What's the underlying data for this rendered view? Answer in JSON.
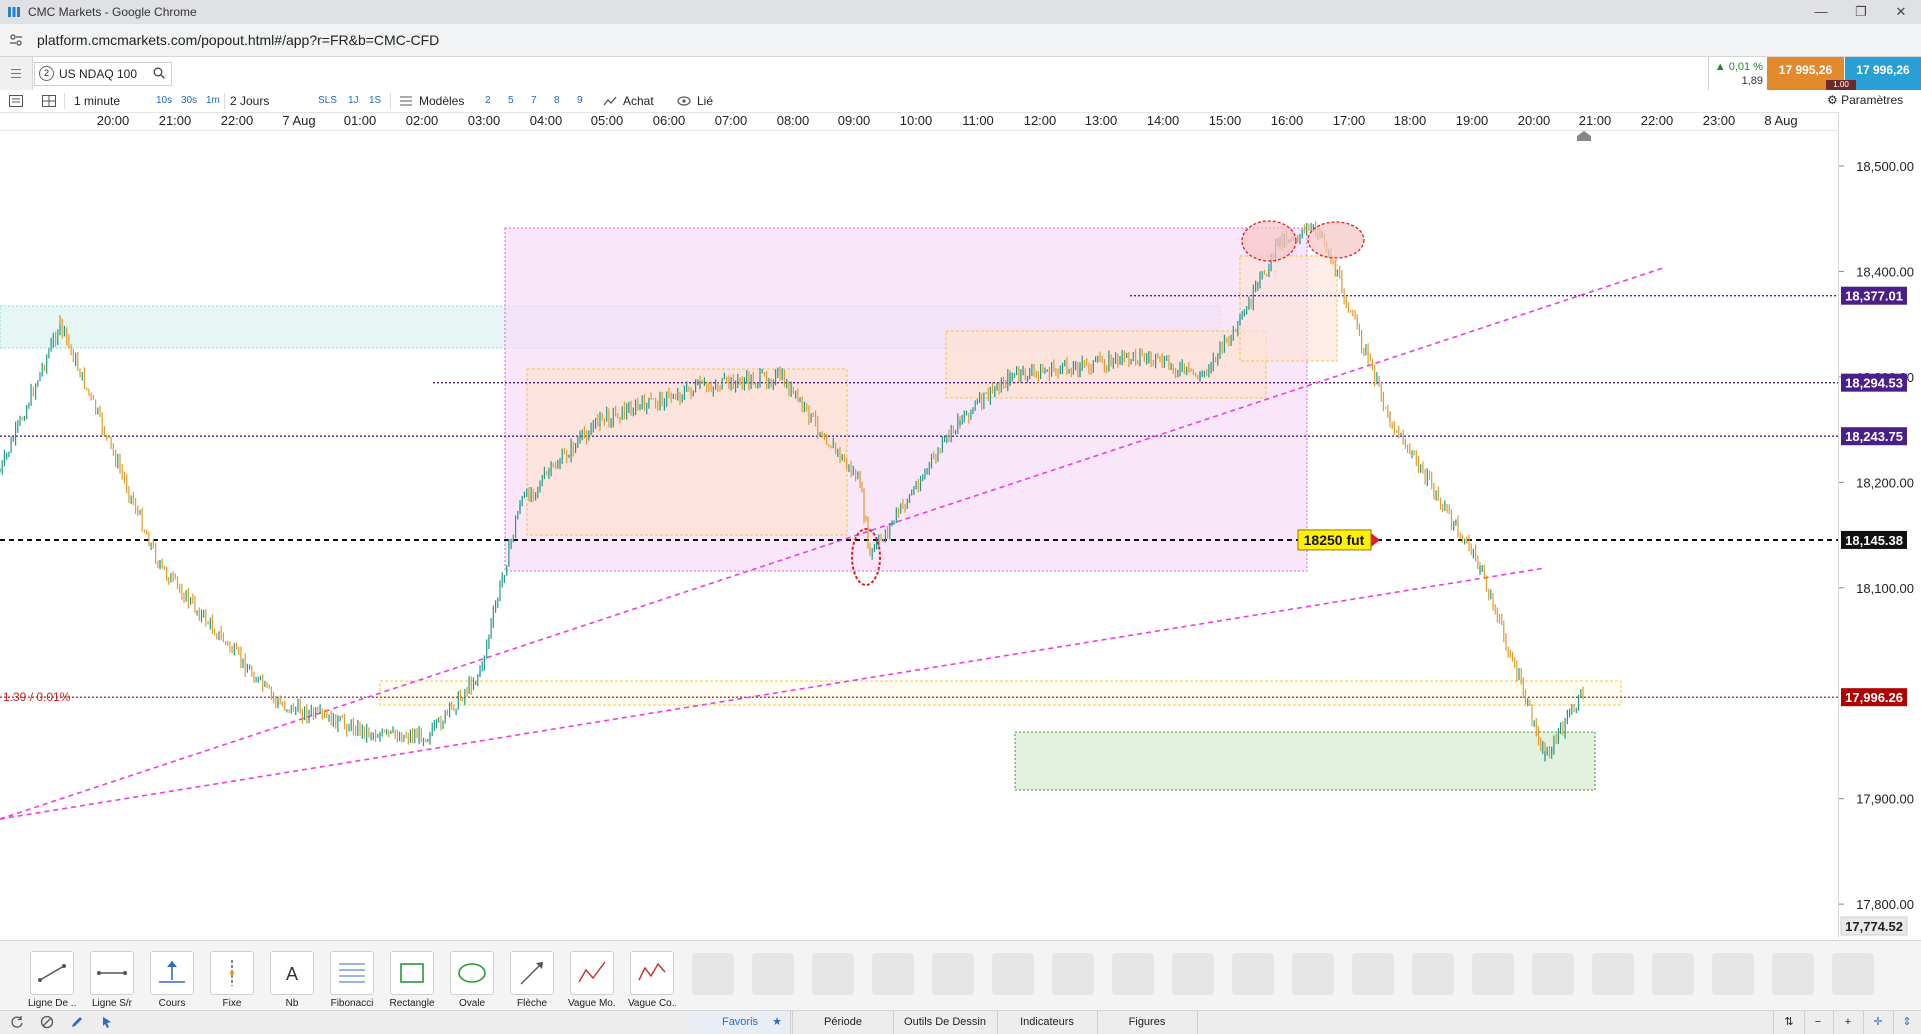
{
  "window": {
    "title": "CMC Markets - Google Chrome",
    "url": "platform.cmcmarkets.com/popout.html#/app?r=FR&b=CMC-CFD"
  },
  "instrument": {
    "number": "2",
    "name": "US NDAQ 100",
    "change_pct": "0,01 %",
    "change_abs": "1,89",
    "sell": "17 995,26",
    "buy": "17 996,26",
    "spread": "1.00"
  },
  "toolbar": {
    "interval": "1 minute",
    "quick_intervals": [
      "10s",
      "30s",
      "1m"
    ],
    "range": "2 Jours",
    "quick_ranges": [
      "SLS",
      "1J",
      "1S"
    ],
    "templates": "Modèles",
    "numbers": [
      "2",
      "5",
      "7",
      "8",
      "9"
    ],
    "buy": "Achat",
    "linked": "Lié",
    "settings": "Paramètres"
  },
  "time_axis": [
    "20:00",
    "21:00",
    "22:00",
    "7 Aug",
    "01:00",
    "02:00",
    "03:00",
    "04:00",
    "05:00",
    "06:00",
    "07:00",
    "08:00",
    "09:00",
    "10:00",
    "11:00",
    "12:00",
    "13:00",
    "14:00",
    "15:00",
    "16:00",
    "17:00",
    "18:00",
    "19:00",
    "20:00",
    "21:00",
    "22:00",
    "23:00",
    "8 Aug"
  ],
  "price_axis": [
    "18,500.00",
    "18,400.00",
    "18,300.00",
    "18,200.00",
    "18,100.00",
    "17,900.00",
    "17,800.00"
  ],
  "price_labels": {
    "line1": "18,377.01",
    "line2": "18,294.53",
    "line3": "18,243.75",
    "black_line": "18,145.38",
    "current": "17,996.26",
    "bottom": "17,774.52"
  },
  "annotations": {
    "fut_label": "18250 fut",
    "change_label": "1.39 / 0.01%"
  },
  "colors": {
    "bull": "#1e9a8a",
    "bear": "#e39a2c",
    "current_price": "#b00000",
    "level_lines": "#4b1f8a",
    "trendlines": "#ee3de0"
  },
  "chart_data": {
    "type": "line",
    "instrument": "US NDAQ 100",
    "interval": "1 minute",
    "x": [
      "20:00",
      "21:00",
      "22:00",
      "7 Aug",
      "01:00",
      "02:00",
      "03:00",
      "04:00",
      "05:00",
      "06:00",
      "07:00",
      "08:00",
      "09:00",
      "10:00",
      "11:00",
      "12:00",
      "13:00",
      "14:00",
      "15:00",
      "16:00",
      "17:00",
      "18:00",
      "19:00",
      "20:00",
      "20:45"
    ],
    "series": [
      {
        "values": [
          18210,
          18350,
          18120,
          17990,
          17960,
          17960,
          18020,
          18180,
          18260,
          18290,
          18300,
          18200,
          18130,
          18260,
          18300,
          18310,
          18320,
          18300,
          18350,
          18430,
          18440,
          18260,
          18120,
          17940,
          18000
        ]
      }
    ],
    "levels": [
      18377.01,
      18294.53,
      18243.75,
      18145.38,
      17996.26
    ],
    "ylim": [
      17774.52,
      18550
    ]
  },
  "drawing_tools": [
    {
      "name": "line",
      "label": "Ligne De ..."
    },
    {
      "name": "sr",
      "label": "Ligne S/r"
    },
    {
      "name": "price",
      "label": "Cours"
    },
    {
      "name": "fixed",
      "label": "Fixe"
    },
    {
      "name": "text",
      "label": "Nb"
    },
    {
      "name": "fibonacci",
      "label": "Fibonacci"
    },
    {
      "name": "rectangle",
      "label": "Rectangle"
    },
    {
      "name": "oval",
      "label": "Ovale"
    },
    {
      "name": "arrow",
      "label": "Flèche"
    },
    {
      "name": "wave1",
      "label": "Vague Mo..."
    },
    {
      "name": "wave2",
      "label": "Vague Co..."
    }
  ],
  "bottom_tabs": [
    "Favoris",
    "Période",
    "Outils De Dessin",
    "Indicateurs",
    "Figures"
  ]
}
